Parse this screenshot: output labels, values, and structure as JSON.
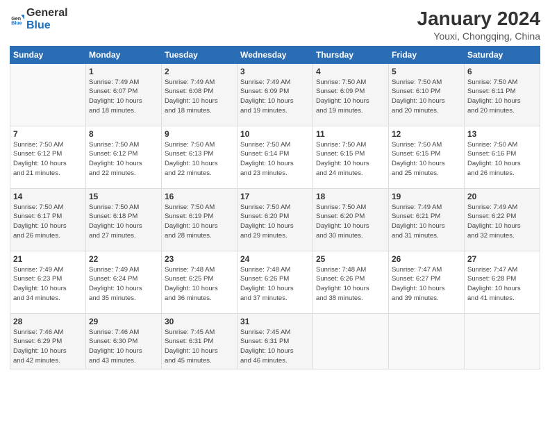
{
  "header": {
    "logo_general": "General",
    "logo_blue": "Blue",
    "title": "January 2024",
    "subtitle": "Youxi, Chongqing, China"
  },
  "columns": [
    "Sunday",
    "Monday",
    "Tuesday",
    "Wednesday",
    "Thursday",
    "Friday",
    "Saturday"
  ],
  "weeks": [
    [
      {
        "day": "",
        "info": ""
      },
      {
        "day": "1",
        "info": "Sunrise: 7:49 AM\nSunset: 6:07 PM\nDaylight: 10 hours\nand 18 minutes."
      },
      {
        "day": "2",
        "info": "Sunrise: 7:49 AM\nSunset: 6:08 PM\nDaylight: 10 hours\nand 18 minutes."
      },
      {
        "day": "3",
        "info": "Sunrise: 7:49 AM\nSunset: 6:09 PM\nDaylight: 10 hours\nand 19 minutes."
      },
      {
        "day": "4",
        "info": "Sunrise: 7:50 AM\nSunset: 6:09 PM\nDaylight: 10 hours\nand 19 minutes."
      },
      {
        "day": "5",
        "info": "Sunrise: 7:50 AM\nSunset: 6:10 PM\nDaylight: 10 hours\nand 20 minutes."
      },
      {
        "day": "6",
        "info": "Sunrise: 7:50 AM\nSunset: 6:11 PM\nDaylight: 10 hours\nand 20 minutes."
      }
    ],
    [
      {
        "day": "7",
        "info": "Sunrise: 7:50 AM\nSunset: 6:12 PM\nDaylight: 10 hours\nand 21 minutes."
      },
      {
        "day": "8",
        "info": "Sunrise: 7:50 AM\nSunset: 6:12 PM\nDaylight: 10 hours\nand 22 minutes."
      },
      {
        "day": "9",
        "info": "Sunrise: 7:50 AM\nSunset: 6:13 PM\nDaylight: 10 hours\nand 22 minutes."
      },
      {
        "day": "10",
        "info": "Sunrise: 7:50 AM\nSunset: 6:14 PM\nDaylight: 10 hours\nand 23 minutes."
      },
      {
        "day": "11",
        "info": "Sunrise: 7:50 AM\nSunset: 6:15 PM\nDaylight: 10 hours\nand 24 minutes."
      },
      {
        "day": "12",
        "info": "Sunrise: 7:50 AM\nSunset: 6:15 PM\nDaylight: 10 hours\nand 25 minutes."
      },
      {
        "day": "13",
        "info": "Sunrise: 7:50 AM\nSunset: 6:16 PM\nDaylight: 10 hours\nand 26 minutes."
      }
    ],
    [
      {
        "day": "14",
        "info": "Sunrise: 7:50 AM\nSunset: 6:17 PM\nDaylight: 10 hours\nand 26 minutes."
      },
      {
        "day": "15",
        "info": "Sunrise: 7:50 AM\nSunset: 6:18 PM\nDaylight: 10 hours\nand 27 minutes."
      },
      {
        "day": "16",
        "info": "Sunrise: 7:50 AM\nSunset: 6:19 PM\nDaylight: 10 hours\nand 28 minutes."
      },
      {
        "day": "17",
        "info": "Sunrise: 7:50 AM\nSunset: 6:20 PM\nDaylight: 10 hours\nand 29 minutes."
      },
      {
        "day": "18",
        "info": "Sunrise: 7:50 AM\nSunset: 6:20 PM\nDaylight: 10 hours\nand 30 minutes."
      },
      {
        "day": "19",
        "info": "Sunrise: 7:49 AM\nSunset: 6:21 PM\nDaylight: 10 hours\nand 31 minutes."
      },
      {
        "day": "20",
        "info": "Sunrise: 7:49 AM\nSunset: 6:22 PM\nDaylight: 10 hours\nand 32 minutes."
      }
    ],
    [
      {
        "day": "21",
        "info": "Sunrise: 7:49 AM\nSunset: 6:23 PM\nDaylight: 10 hours\nand 34 minutes."
      },
      {
        "day": "22",
        "info": "Sunrise: 7:49 AM\nSunset: 6:24 PM\nDaylight: 10 hours\nand 35 minutes."
      },
      {
        "day": "23",
        "info": "Sunrise: 7:48 AM\nSunset: 6:25 PM\nDaylight: 10 hours\nand 36 minutes."
      },
      {
        "day": "24",
        "info": "Sunrise: 7:48 AM\nSunset: 6:26 PM\nDaylight: 10 hours\nand 37 minutes."
      },
      {
        "day": "25",
        "info": "Sunrise: 7:48 AM\nSunset: 6:26 PM\nDaylight: 10 hours\nand 38 minutes."
      },
      {
        "day": "26",
        "info": "Sunrise: 7:47 AM\nSunset: 6:27 PM\nDaylight: 10 hours\nand 39 minutes."
      },
      {
        "day": "27",
        "info": "Sunrise: 7:47 AM\nSunset: 6:28 PM\nDaylight: 10 hours\nand 41 minutes."
      }
    ],
    [
      {
        "day": "28",
        "info": "Sunrise: 7:46 AM\nSunset: 6:29 PM\nDaylight: 10 hours\nand 42 minutes."
      },
      {
        "day": "29",
        "info": "Sunrise: 7:46 AM\nSunset: 6:30 PM\nDaylight: 10 hours\nand 43 minutes."
      },
      {
        "day": "30",
        "info": "Sunrise: 7:45 AM\nSunset: 6:31 PM\nDaylight: 10 hours\nand 45 minutes."
      },
      {
        "day": "31",
        "info": "Sunrise: 7:45 AM\nSunset: 6:31 PM\nDaylight: 10 hours\nand 46 minutes."
      },
      {
        "day": "",
        "info": ""
      },
      {
        "day": "",
        "info": ""
      },
      {
        "day": "",
        "info": ""
      }
    ]
  ]
}
